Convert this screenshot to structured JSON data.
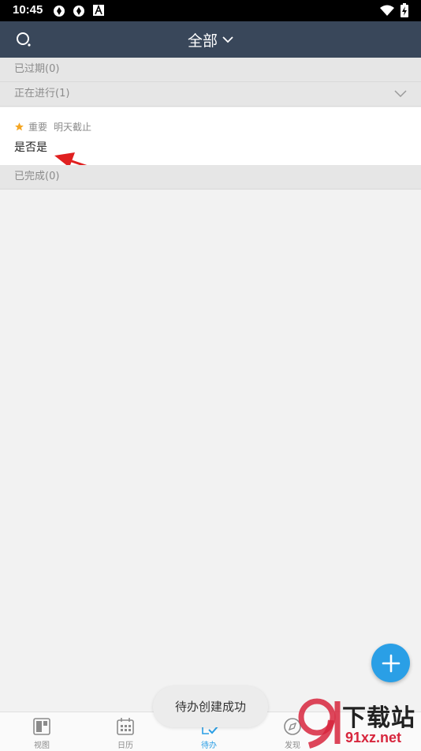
{
  "status_bar": {
    "time": "10:45"
  },
  "header": {
    "title": "全部"
  },
  "sections": {
    "expired": "已过期(0)",
    "in_progress": "正在进行(1)",
    "completed": "已完成(0)"
  },
  "task": {
    "tag": "重要",
    "due": "明天截止",
    "title": "是否是"
  },
  "toast": "待办创建成功",
  "bottom_nav": {
    "view": "视图",
    "calendar": "日历",
    "todo": "待办",
    "discover": "发现"
  },
  "watermark": {
    "text": "下载站",
    "url": "91xz.net"
  },
  "colors": {
    "header_bg": "#39475a",
    "accent": "#2a9fe6",
    "star": "#f5a623",
    "arrow": "#e02020"
  }
}
